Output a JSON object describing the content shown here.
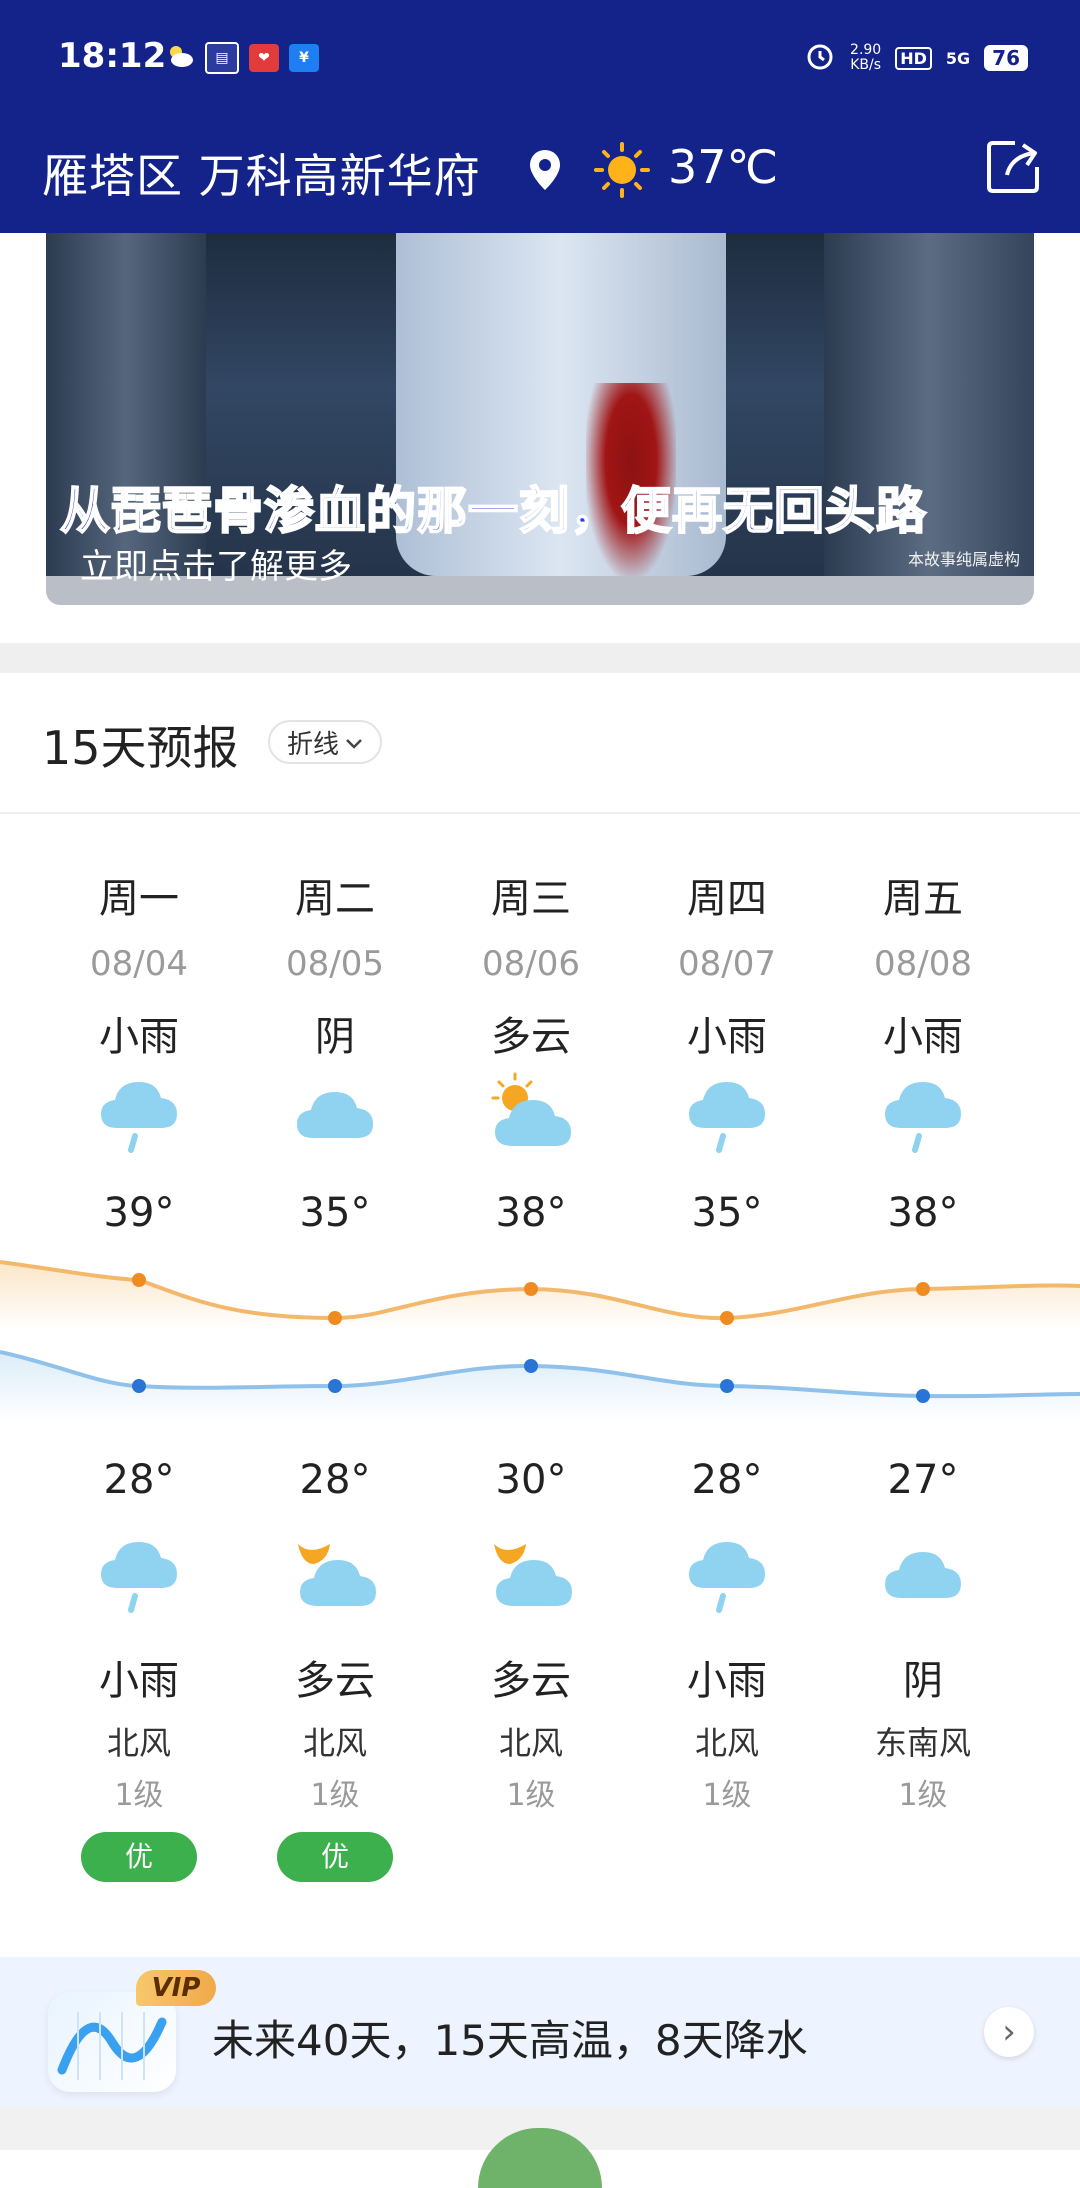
{
  "status_bar": {
    "time": "18:12",
    "net_speed_value": "2.90",
    "net_speed_unit": "KB/s",
    "hd": "HD",
    "network": "5G",
    "battery": "76"
  },
  "header": {
    "location": "雁塔区 万科高新华府",
    "current_temp": "37℃",
    "icons": [
      "location-pin-icon",
      "sun-icon",
      "share-icon"
    ]
  },
  "banner": {
    "headline": "从琵琶骨渗血的那一刻，便再无回头路",
    "subtext": "立即点击了解更多",
    "disclaimer": "本故事纯属虚构"
  },
  "forecast": {
    "title": "15天预报",
    "mode_label": "折线",
    "days": [
      {
        "weekday": "周一",
        "date": "08/04",
        "day_cond": "小雨",
        "high": "39°",
        "low": "28°",
        "night_cond": "小雨",
        "wind": "北风",
        "level": "1级",
        "aqi": "优",
        "day_icon": "rain-icon",
        "night_icon": "rain-icon"
      },
      {
        "weekday": "周二",
        "date": "08/05",
        "day_cond": "阴",
        "high": "35°",
        "low": "28°",
        "night_cond": "多云",
        "wind": "北风",
        "level": "1级",
        "aqi": "优",
        "day_icon": "cloud-icon",
        "night_icon": "moon-cloud-icon"
      },
      {
        "weekday": "周三",
        "date": "08/06",
        "day_cond": "多云",
        "high": "38°",
        "low": "30°",
        "night_cond": "多云",
        "wind": "北风",
        "level": "1级",
        "aqi": "",
        "day_icon": "sun-cloud-icon",
        "night_icon": "moon-cloud-icon"
      },
      {
        "weekday": "周四",
        "date": "08/07",
        "day_cond": "小雨",
        "high": "35°",
        "low": "28°",
        "night_cond": "小雨",
        "wind": "北风",
        "level": "1级",
        "aqi": "",
        "day_icon": "rain-icon",
        "night_icon": "rain-icon"
      },
      {
        "weekday": "周五",
        "date": "08/08",
        "day_cond": "小雨",
        "high": "38°",
        "low": "27°",
        "night_cond": "阴",
        "wind": "东南风",
        "level": "1级",
        "aqi": "",
        "day_icon": "rain-icon",
        "night_icon": "cloud-icon"
      }
    ],
    "colors": {
      "high_line": "#f3b86b",
      "low_line": "#8fc1ea",
      "high_dot": "#ef8c21",
      "low_dot": "#2a74d6",
      "aqi_good": "#3bb04d"
    }
  },
  "vip": {
    "badge": "VIP",
    "text": "未来40天，15天高温，8天降水",
    "arrow": "›"
  }
}
